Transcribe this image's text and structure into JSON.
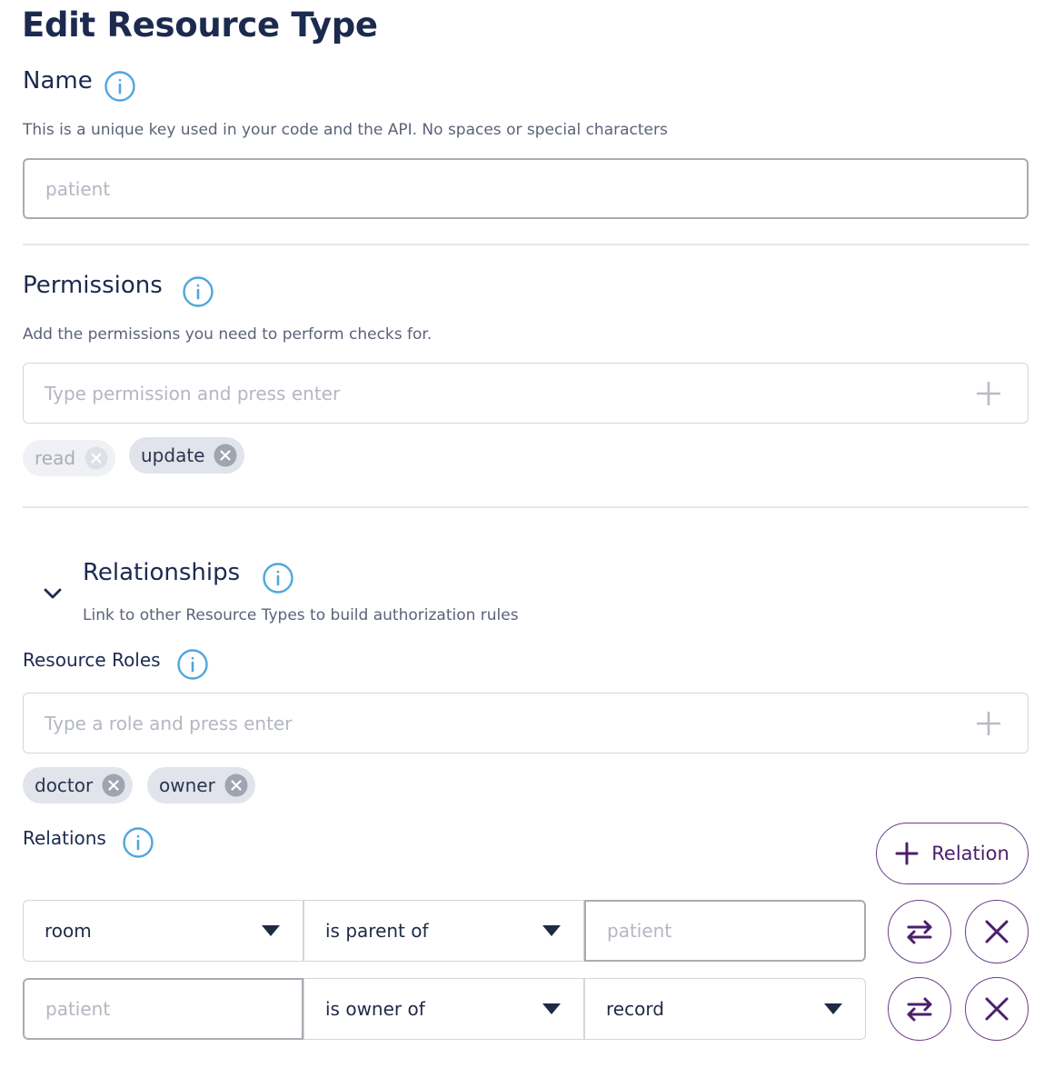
{
  "page": {
    "title": "Edit Resource Type"
  },
  "name_section": {
    "heading": "Name",
    "description": "This is a unique key used in your code and the API. No spaces or special characters",
    "placeholder": "patient"
  },
  "permissions_section": {
    "heading": "Permissions",
    "description": "Add the permissions you need to perform checks for.",
    "placeholder": "Type permission and press enter",
    "chips": [
      {
        "label": "read",
        "state": "disabled"
      },
      {
        "label": "update",
        "state": "active"
      }
    ]
  },
  "relationships_section": {
    "heading": "Relationships",
    "description": "Link to other Resource Types to build authorization rules",
    "toggle_icon": "chevron-down-icon"
  },
  "resource_roles": {
    "heading": "Resource Roles",
    "placeholder": "Type a role and press enter",
    "chips": [
      {
        "label": "doctor"
      },
      {
        "label": "owner"
      }
    ]
  },
  "relations": {
    "heading": "Relations",
    "add_button_label": "Relation",
    "rows": [
      {
        "subject": "room",
        "relation": "is parent of",
        "object_placeholder": "patient"
      },
      {
        "subject_placeholder": "patient",
        "relation": "is owner of",
        "object": "record"
      }
    ]
  },
  "colors": {
    "heading": "#1c2a4f",
    "info_icon": "#4fa6dc",
    "accent_purple": "#4a1f6d",
    "chip_bg": "#e1e4ea"
  }
}
